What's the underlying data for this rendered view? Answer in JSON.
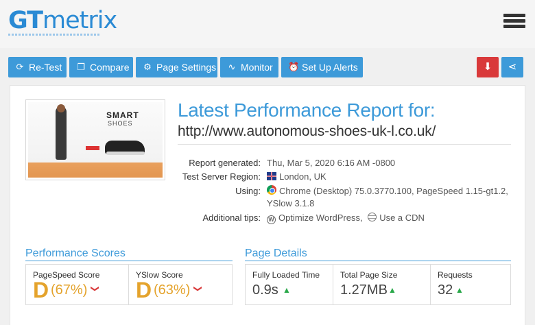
{
  "header": {
    "logo_gt": "GT",
    "logo_rest": "metrix",
    "menu_icon": "hamburger-icon"
  },
  "toolbar": {
    "retest": "Re-Test",
    "compare": "Compare",
    "page_settings": "Page Settings",
    "monitor": "Monitor",
    "alerts": "Set Up Alerts",
    "pdf_icon": "pdf-icon",
    "share_icon": "share-icon"
  },
  "colors": {
    "brand_blue": "#3d9ad9",
    "pdf_red": "#d9393a",
    "grade_orange": "#e4a32c",
    "up_green": "#2aa84a"
  },
  "thumbnail": {
    "title": "SMART",
    "subtitle": "SHOES"
  },
  "report": {
    "title": "Latest Performance Report for:",
    "url": "http://www.autonomous-shoes-uk-l.co.uk/",
    "generated_label": "Report generated:",
    "generated_value": "Thu, Mar 5, 2020 6:16 AM -0800",
    "region_label": "Test Server Region:",
    "region_value": "London, UK",
    "using_label": "Using:",
    "using_line1": "Chrome (Desktop) 75.0.3770.100, PageSpeed 1.15-gt1.2,",
    "using_line2": "YSlow 3.1.8",
    "tips_label": "Additional tips:",
    "tip_wp": "Optimize WordPress,",
    "tip_cdn": "Use a CDN"
  },
  "performance": {
    "title": "Performance Scores",
    "pagespeed_label": "PageSpeed Score",
    "pagespeed_grade": "D",
    "pagespeed_pct": "(67%)",
    "yslow_label": "YSlow Score",
    "yslow_grade": "D",
    "yslow_pct": "(63%)"
  },
  "details": {
    "title": "Page Details",
    "load_label": "Fully Loaded Time",
    "load_value": "0.9s",
    "size_label": "Total Page Size",
    "size_value": "1.27MB",
    "req_label": "Requests",
    "req_value": "32"
  }
}
